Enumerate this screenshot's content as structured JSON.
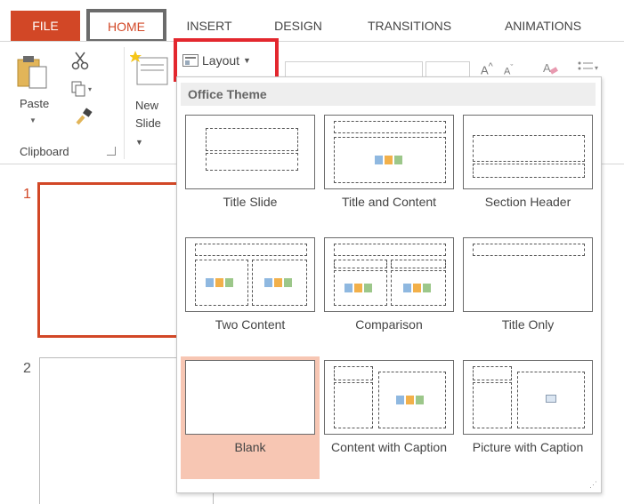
{
  "tabs": {
    "file": "FILE",
    "home": "HOME",
    "insert": "INSERT",
    "design": "DESIGN",
    "transitions": "TRANSITIONS",
    "animations": "ANIMATIONS"
  },
  "ribbon": {
    "paste_label": "Paste",
    "clipboard_label": "Clipboard",
    "new_slide_label_line1": "New",
    "new_slide_label_line2": "Slide",
    "layout_label": "Layout"
  },
  "slides": {
    "slide1_number": "1",
    "slide2_number": "2"
  },
  "layout_dropdown": {
    "theme_name": "Office Theme",
    "items": [
      {
        "label": "Title Slide",
        "selected": false
      },
      {
        "label": "Title and Content",
        "selected": false
      },
      {
        "label": "Section Header",
        "selected": false
      },
      {
        "label": "Two Content",
        "selected": false
      },
      {
        "label": "Comparison",
        "selected": false
      },
      {
        "label": "Title Only",
        "selected": false
      },
      {
        "label": "Blank",
        "selected": true
      },
      {
        "label": "Content with Caption",
        "selected": false
      },
      {
        "label": "Picture with Caption",
        "selected": false
      }
    ]
  },
  "colors": {
    "accent": "#d24726",
    "highlight_red": "#e3272e",
    "home_tab_border": "#6b6b6b",
    "selected_item_bg": "#f7c6b3"
  }
}
